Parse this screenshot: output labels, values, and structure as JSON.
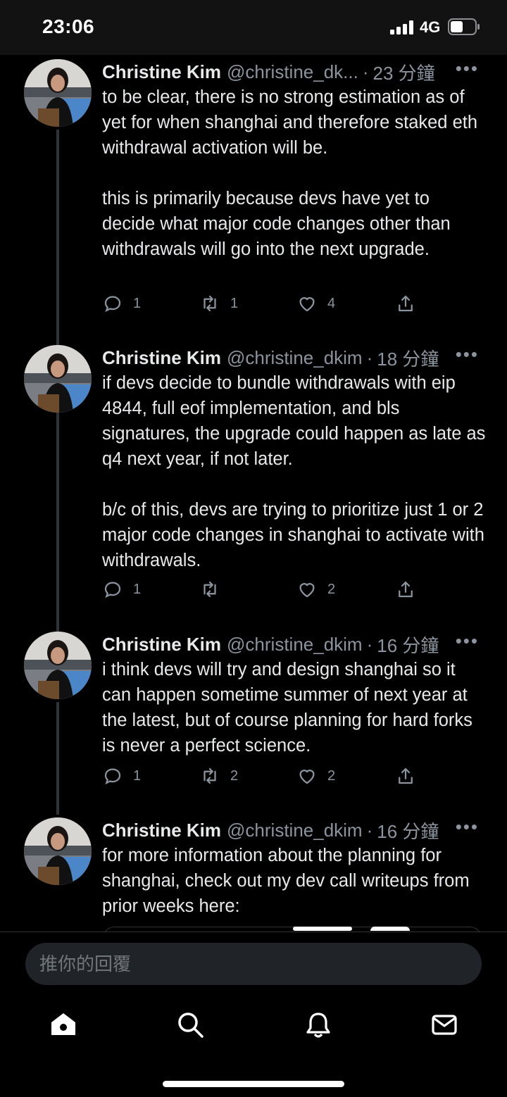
{
  "status_bar": {
    "time": "23:06",
    "network": "4G"
  },
  "tweets": [
    {
      "name": "Christine Kim",
      "handle": "@christine_dk...",
      "sep": "·",
      "time": "23 分鐘",
      "paragraphs": [
        "to be clear, there is no strong estimation as of yet for when shanghai and therefore staked eth withdrawal activation will be.",
        "this is primarily because devs have yet to decide what major code changes other than withdrawals will go into the next upgrade."
      ],
      "replies": "1",
      "retweets": "1",
      "likes": "4"
    },
    {
      "name": "Christine Kim",
      "handle": "@christine_dkim",
      "sep": "·",
      "time": "18 分鐘",
      "paragraphs": [
        "if devs decide to bundle withdrawals with eip 4844, full eof implementation, and bls signatures, the upgrade could happen as late as q4 next year, if not later.",
        "b/c of this, devs are trying to prioritize just 1 or 2 major code changes in shanghai to activate with withdrawals."
      ],
      "replies": "1",
      "retweets": "",
      "likes": "2"
    },
    {
      "name": "Christine Kim",
      "handle": "@christine_dkim",
      "sep": "·",
      "time": "16 分鐘",
      "paragraphs": [
        "i think devs will try and design shanghai so it can happen sometime summer of next year at the latest, but of course planning for hard forks is never a perfect science."
      ],
      "replies": "1",
      "retweets": "2",
      "likes": "2"
    },
    {
      "name": "Christine Kim",
      "handle": "@christine_dkim",
      "sep": "·",
      "time": "16 分鐘",
      "paragraphs": [
        "for more information about the planning for shanghai, check out my dev call writeups from prior weeks here:"
      ]
    }
  ],
  "reply_box": {
    "placeholder": "推你的回覆"
  },
  "nav": [
    "home-icon",
    "search-icon",
    "notifications-icon",
    "messages-icon"
  ],
  "colors": {
    "background": "#000000",
    "text": "#e7e9ea",
    "muted": "#8b949e",
    "input": "#202327"
  }
}
